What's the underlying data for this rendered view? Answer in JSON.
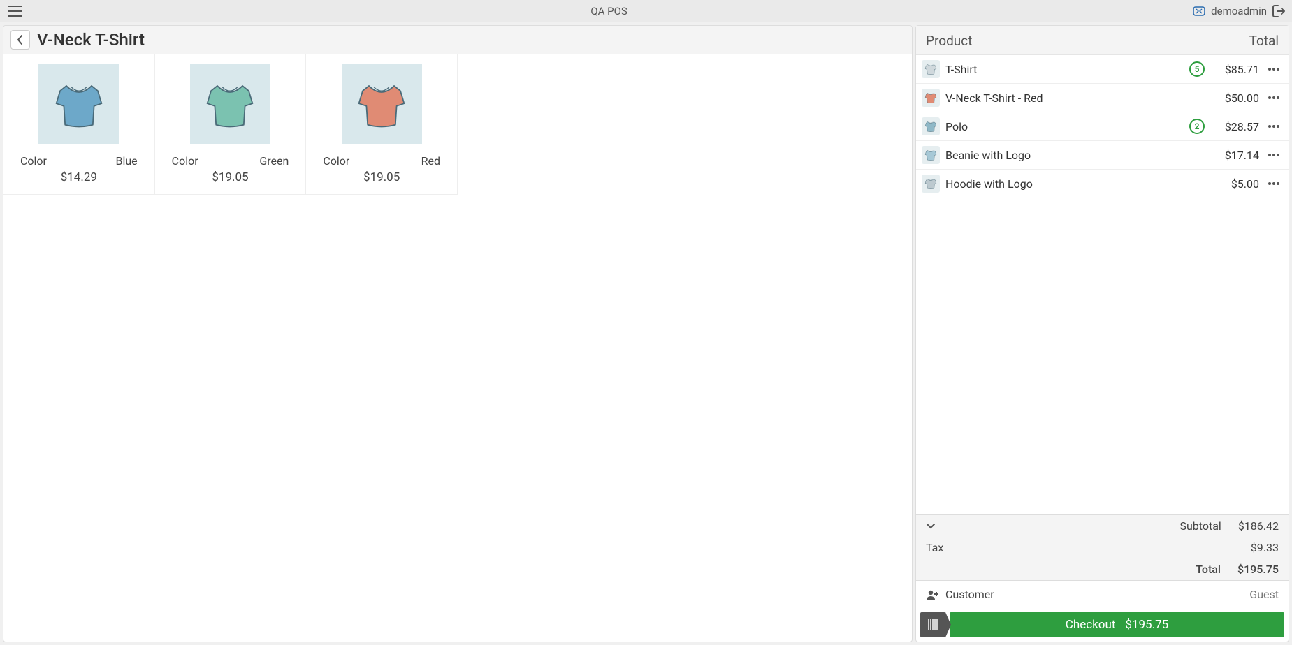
{
  "topbar": {
    "title": "QA POS",
    "username": "demoadmin"
  },
  "page": {
    "title": "V-Neck T-Shirt"
  },
  "products": [
    {
      "attr_label": "Color",
      "attr_value": "Blue",
      "price": "$14.29",
      "tint": "#6da8c9"
    },
    {
      "attr_label": "Color",
      "attr_value": "Green",
      "price": "$19.05",
      "tint": "#7bc2b0"
    },
    {
      "attr_label": "Color",
      "attr_value": "Red",
      "price": "$19.05",
      "tint": "#e08b74"
    }
  ],
  "cart": {
    "header_product": "Product",
    "header_total": "Total",
    "items": [
      {
        "name": "T-Shirt",
        "qty": "5",
        "price": "$85.71",
        "tint": "#cfd8dc"
      },
      {
        "name": "V-Neck T-Shirt - Red",
        "qty": "",
        "price": "$50.00",
        "tint": "#e08b74"
      },
      {
        "name": "Polo",
        "qty": "2",
        "price": "$28.57",
        "tint": "#8fb8c7"
      },
      {
        "name": "Beanie with Logo",
        "qty": "",
        "price": "$17.14",
        "tint": "#a6c8d6"
      },
      {
        "name": "Hoodie with Logo",
        "qty": "",
        "price": "$5.00",
        "tint": "#bcc9cf"
      }
    ]
  },
  "totals": {
    "subtotal_label": "Subtotal",
    "subtotal_value": "$186.42",
    "tax_label": "Tax",
    "tax_value": "$9.33",
    "total_label": "Total",
    "total_value": "$195.75"
  },
  "customer": {
    "label": "Customer",
    "value": "Guest"
  },
  "checkout": {
    "label": "Checkout",
    "amount": "$195.75"
  }
}
